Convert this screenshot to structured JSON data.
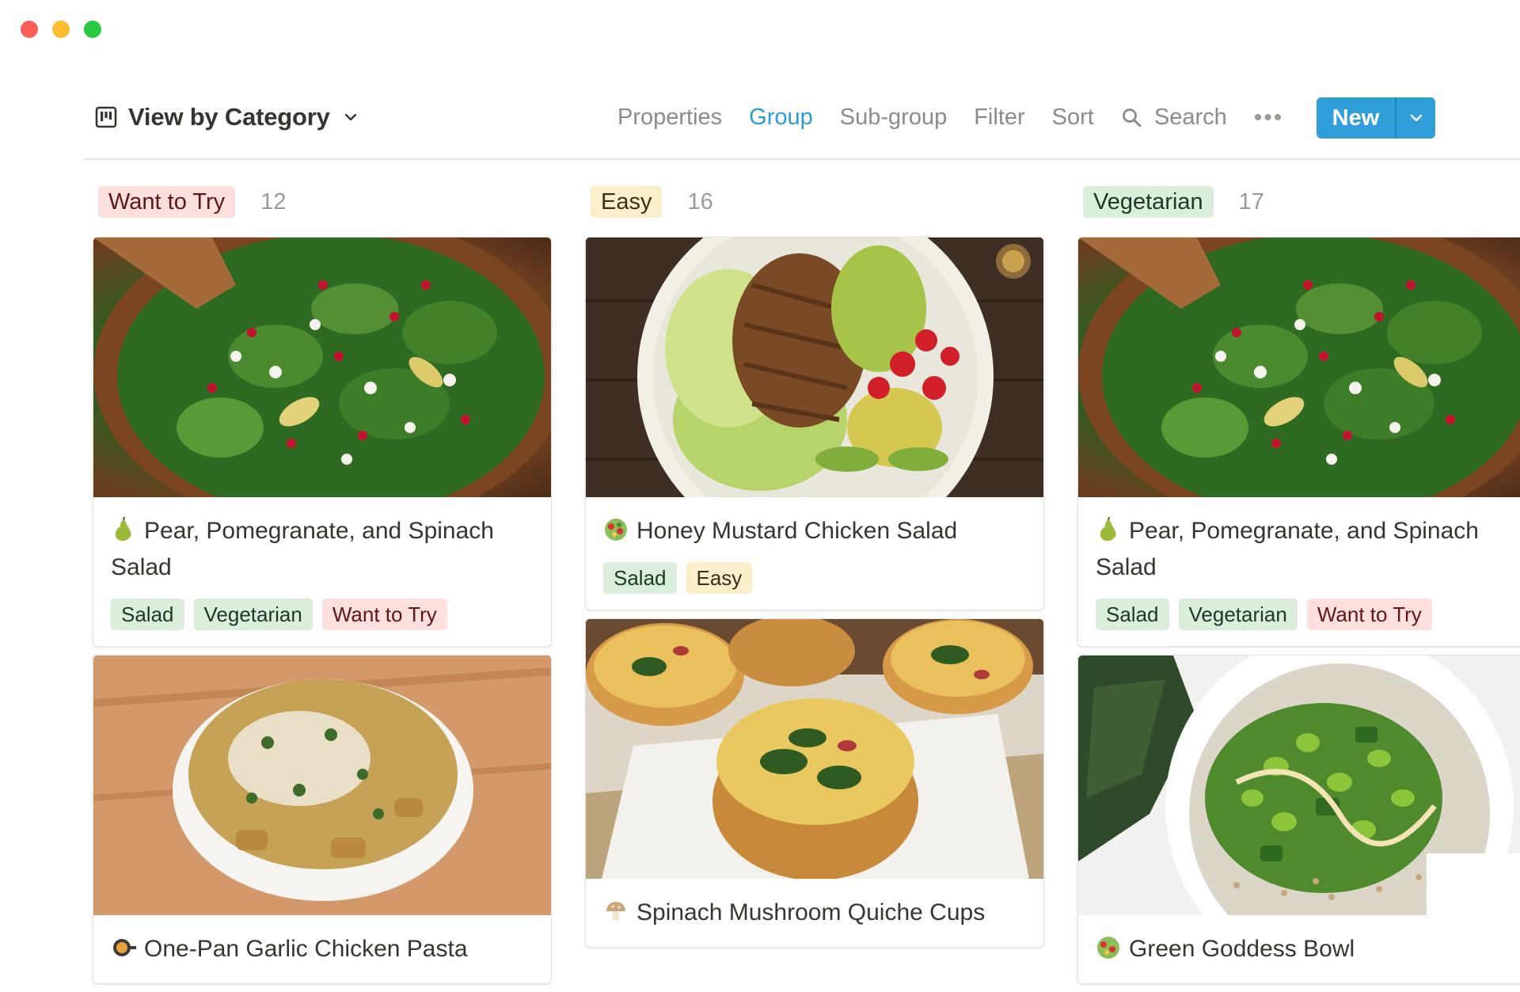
{
  "window": {
    "controls": [
      "close",
      "minimize",
      "zoom"
    ]
  },
  "toolbar": {
    "view_icon": "board-view-icon",
    "view_label": "View by Category",
    "actions": {
      "properties": "Properties",
      "group": "Group",
      "subgroup": "Sub-group",
      "filter": "Filter",
      "sort": "Sort",
      "search": "Search",
      "more": "•••"
    },
    "new_label": "New",
    "accent": "#2f9ed9"
  },
  "columns": [
    {
      "label": "Want to Try",
      "count": "12",
      "color": "#fde0dd",
      "cards": [
        {
          "emoji": "pear-icon",
          "title": "Pear, Pomegranate, and Spinach Salad",
          "tags": [
            {
              "label": "Salad",
              "color": "green"
            },
            {
              "label": "Vegetarian",
              "color": "green"
            },
            {
              "label": "Want to Try",
              "color": "red"
            }
          ]
        },
        {
          "emoji": "pan-icon",
          "title": "One-Pan Garlic Chicken Pasta",
          "tags": []
        }
      ]
    },
    {
      "label": "Easy",
      "count": "16",
      "color": "#fbeecb",
      "cards": [
        {
          "emoji": "salad-icon",
          "title": "Honey Mustard Chicken Salad",
          "tags": [
            {
              "label": "Salad",
              "color": "green"
            },
            {
              "label": "Easy",
              "color": "yellow"
            }
          ]
        },
        {
          "emoji": "mushroom-icon",
          "title": "Spinach Mushroom Quiche Cups",
          "tags": []
        }
      ]
    },
    {
      "label": "Vegetarian",
      "count": "17",
      "color": "#dbeddb",
      "cards": [
        {
          "emoji": "pear-icon",
          "title": "Pear, Pomegranate, and Spinach Salad",
          "tags": [
            {
              "label": "Salad",
              "color": "green"
            },
            {
              "label": "Vegetarian",
              "color": "green"
            },
            {
              "label": "Want to Try",
              "color": "red"
            }
          ]
        },
        {
          "emoji": "salad-icon",
          "title": "Green Goddess Bowl",
          "tags": []
        }
      ]
    }
  ]
}
